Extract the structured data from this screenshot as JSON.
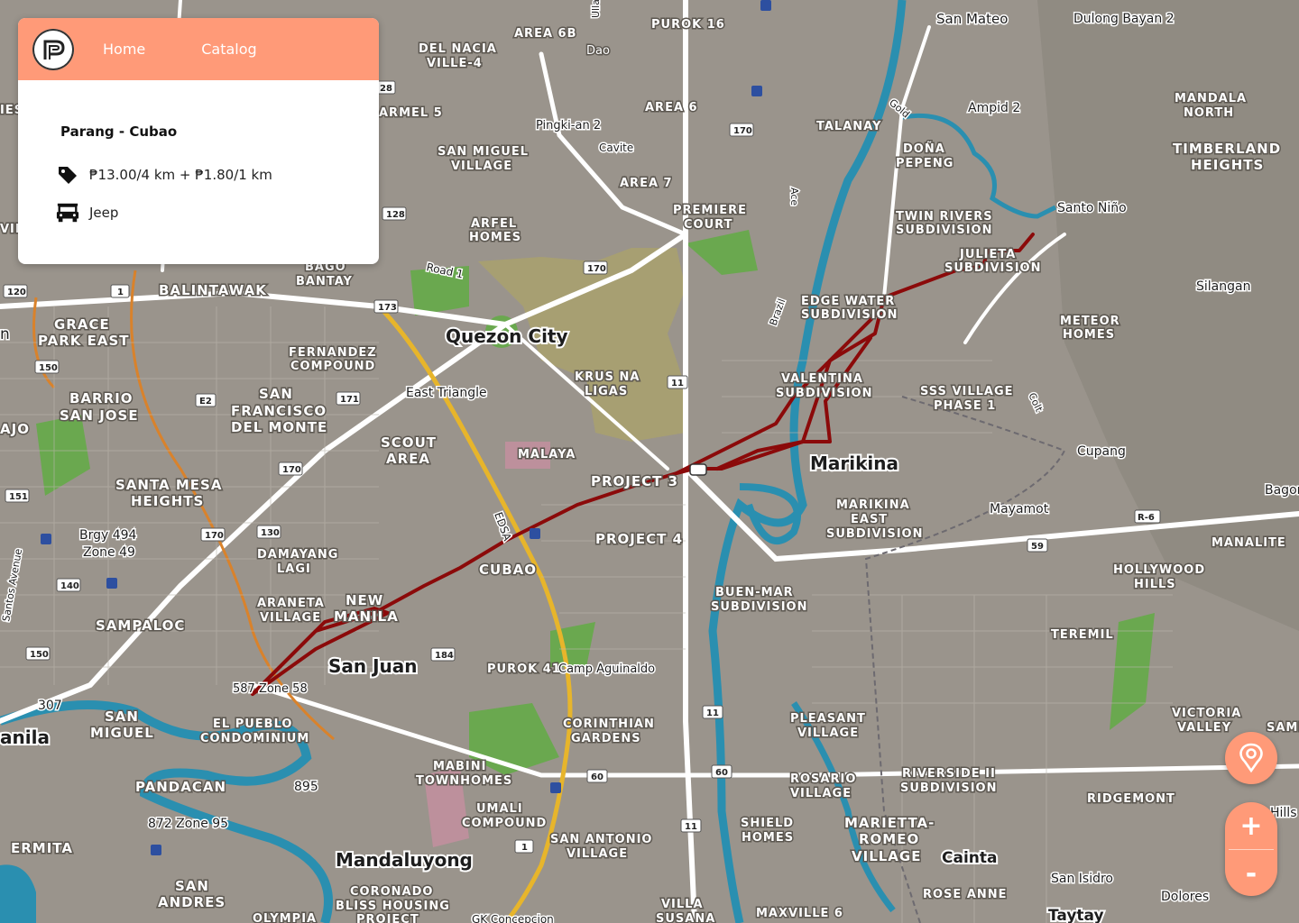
{
  "header": {
    "logo_alt": "P",
    "nav": {
      "home": "Home",
      "catalog": "Catalog"
    }
  },
  "route": {
    "title": "Parang - Cubao",
    "fare": "₱13.00/4 km + ₱1.80/1 km",
    "vehicle": "Jeep",
    "line_color": "#8b0a0a"
  },
  "controls": {
    "zoom_in": "+",
    "zoom_out": "-"
  },
  "colors": {
    "accent": "#ff9a78",
    "water": "#2a8fb0",
    "park": "#6aa84f",
    "land": "#9a948c"
  },
  "map": {
    "places": {
      "san_mateo": "San Mateo",
      "dulong_bayan": "Dulong Bayan 2",
      "purok16": "PUROK 16",
      "area6b": "AREA 6B",
      "dao": "Dao",
      "del_nacia": "DEL NACIA",
      "ville4": "VILLE-4",
      "area6": "AREA 6",
      "pingki": "Pingki-an 2",
      "cavite": "Cavite",
      "talanay": "TALANAY",
      "ampid": "Ampid 2",
      "mandala1": "MANDALA",
      "mandala2": "NORTH",
      "gold": "Gold",
      "dona1": "DOÑA",
      "dona2": "PEPENG",
      "timber1": "TIMBERLAND",
      "timber2": "HEIGHTS",
      "san_miguel1": "SAN MIGUEL",
      "san_miguel2": "VILLAGE",
      "area7": "AREA 7",
      "premiere1": "PREMIERE",
      "premiere2": "COURT",
      "ace": "Ace",
      "twin1": "TWIN RIVERS",
      "twin2": "SUBDIVISION",
      "santo_nino": "Santo Niño",
      "arfel1": "ARFEL",
      "arfel2": "HOMES",
      "julieta1": "JULIETA",
      "julieta2": "SUBDIVISION",
      "silangan": "Silangan",
      "road1": "Road 1",
      "bago1": "BAGO",
      "bago2": "BANTAY",
      "balintawak": "BALINTAWAK",
      "edgewater1": "EDGE WATER",
      "edgewater2": "SUBDIVISION",
      "brazil": "Brazil",
      "meteor1": "METEOR",
      "meteor2": "HOMES",
      "quezon_city": "Quezon City",
      "grace1": "GRACE",
      "grace2": "PARK EAST",
      "fernandez1": "FERNANDEZ",
      "fernandez2": "COMPOUND",
      "krus1": "KRUS NA",
      "krus2": "LIGAS",
      "valentina1": "VALENTINA",
      "valentina2": "SUBDIVISION",
      "sss1": "SSS VILLAGE",
      "sss2": "PHASE 1",
      "colt": "Colt",
      "east_triangle": "East Triangle",
      "barrio1": "BARRIO",
      "barrio2": "SAN JOSE",
      "sanfran1": "SAN",
      "sanfran2": "FRANCISCO",
      "sanfran3": "DEL MONTE",
      "cupang": "Cupang",
      "scout1": "SCOUT",
      "scout2": "AREA",
      "malaya": "MALAYA",
      "marikina": "Marikina",
      "project3": "PROJECT 3",
      "bagong": "Bagon",
      "santamesa1": "SANTA MESA",
      "santamesa2": "HEIGHTS",
      "marikina_east1": "MARIKINA",
      "marikina_east2": "EAST",
      "marikina_east3": "SUBDIVISION",
      "mayamot": "Mayamot",
      "brgy494a": "Brgy 494",
      "brgy494b": "Zone 49",
      "edsa": "EDSA",
      "project4": "PROJECT 4",
      "manalite": "MANALITE",
      "damayang1": "DAMAYANG",
      "damayang2": "LAGI",
      "cubao": "CUBAO",
      "hollywood1": "HOLLYWOOD",
      "hollywood2": "HILLS",
      "araneta1": "ARANETA",
      "araneta2": "VILLAGE",
      "newmanila1": "NEW",
      "newmanila2": "MANILA",
      "buenmar1": "BUEN-MAR",
      "buenmar2": "SUBDIVISION",
      "sampaloc": "SAMPALOC",
      "teremil": "TEREMIL",
      "san_juan": "San Juan",
      "purok41": "PUROK 41",
      "camp": "Camp Aguinaldo",
      "zone58": "587 Zone 58",
      "n307": "307",
      "sanmiguel_m1": "SAN",
      "sanmiguel_m2": "MIGUEL",
      "manila": "anila",
      "pueblo1": "EL PUEBLO",
      "pueblo2": "CONDOMINIUM",
      "corinthian1": "CORINTHIAN",
      "corinthian2": "GARDENS",
      "pleasant1": "PLEASANT",
      "pleasant2": "VILLAGE",
      "victoria1": "VICTORIA",
      "victoria2": "VALLEY",
      "samp": "SAMP",
      "mabini1": "MABINI",
      "mabini2": "TOWNHOMES",
      "riverside1": "RIVERSIDE II",
      "riverside2": "SUBDIVISION",
      "pandacan": "PANDACAN",
      "n895": "895",
      "rosario1": "ROSARIO",
      "rosario2": "VILLAGE",
      "ridgemont": "RIDGEMONT",
      "hills": "Hills",
      "zone95": "872 Zone 95",
      "umali1": "UMALI",
      "umali2": "COMPOUND",
      "shield1": "SHIELD",
      "shield2": "HOMES",
      "marietta1": "MARIETTA-",
      "marietta2": "ROMEO",
      "marietta3": "VILLAGE",
      "ermita": "ERMITA",
      "santonio1": "SAN ANTONIO",
      "santonio2": "VILLAGE",
      "mandaluyong": "Mandaluyong",
      "cainta": "Cainta",
      "san_isidro": "San Isidro",
      "sanandres1": "SAN",
      "sanandres2": "ANDRES",
      "coronado1": "CORONADO",
      "coronado2": "BLISS HOUSING",
      "coronado3": "PROJECT",
      "villa1": "VILLA",
      "villa2": "SUSANA",
      "maxville": "MAXVILLE 6",
      "rose_anne": "ROSE ANNE",
      "dolores": "Dolores",
      "taytay": "Taytay",
      "olympia": "OLYMPIA",
      "gk": "GK Concepcion",
      "hi_n": "n",
      "hi_ajo": "AJO",
      "hi_ville": "VILLE",
      "santos": "Santos Avenue",
      "armel": "ARMEL 5",
      "uilla": "Ulla",
      "ies": "IES"
    },
    "shields": {
      "s170a": "170",
      "s128": "128",
      "s170b": "170",
      "s120": "120",
      "s1a": "1",
      "s173": "173",
      "s150a": "150",
      "sE2": "E2",
      "s171": "171",
      "s11a": "11",
      "s151": "151",
      "s170c": "170",
      "s130": "130",
      "s170d": "170",
      "s140": "140",
      "s59": "59",
      "sR6": "R-6",
      "s150b": "150",
      "s184": "184",
      "s11b": "11",
      "s60a": "60",
      "s60b": "60",
      "s11c": "11",
      "s1b": "1",
      "s28": "28"
    }
  }
}
